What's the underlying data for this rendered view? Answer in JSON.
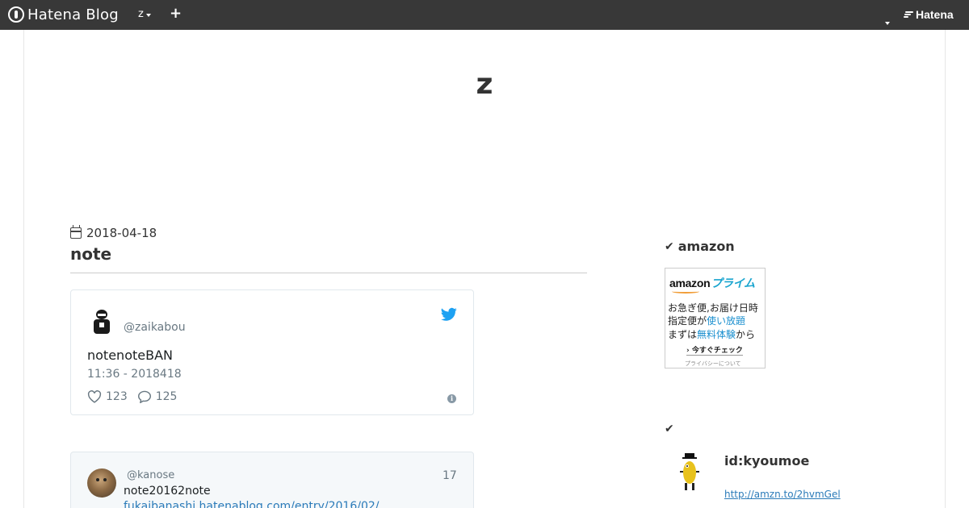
{
  "topbar": {
    "logo_text": "Hatena Blog",
    "blog_switch": "z",
    "plus": "+",
    "hatena": "Hatena"
  },
  "blog": {
    "title": "z"
  },
  "entry": {
    "date": "2018-04-18",
    "title": "note"
  },
  "tweet": {
    "handle": "@zaikabou",
    "text": "notenoteBAN",
    "time": "11:36 - 2018418",
    "likes": "123",
    "replies": "125",
    "info": "i"
  },
  "embed": {
    "handle": "@kanose",
    "count": "17",
    "text": "note20162note",
    "link": "fukaibanashi.hatenablog.com/entry/2016/02/"
  },
  "sidebar": {
    "amazon_heading": "amazon",
    "amazon_ad": {
      "logo": "amazon",
      "prime": "プライム",
      "line1": "お急ぎ便,お届け日時",
      "line2_a": "指定便が",
      "line2_b": "使い放題",
      "line3_a": "まずは",
      "line3_b": "無料体験",
      "line3_c": "から",
      "cta": "› 今すぐチェック",
      "privacy": "プライバシーについて"
    },
    "profile": {
      "id": "id:kyoumoe",
      "link": "http://amzn.to/2hvmGel"
    }
  },
  "colors": {
    "topbar": "#383838",
    "link": "#2b7bb9",
    "twitter": "#1da1f2",
    "prime": "#1aa5cf"
  }
}
